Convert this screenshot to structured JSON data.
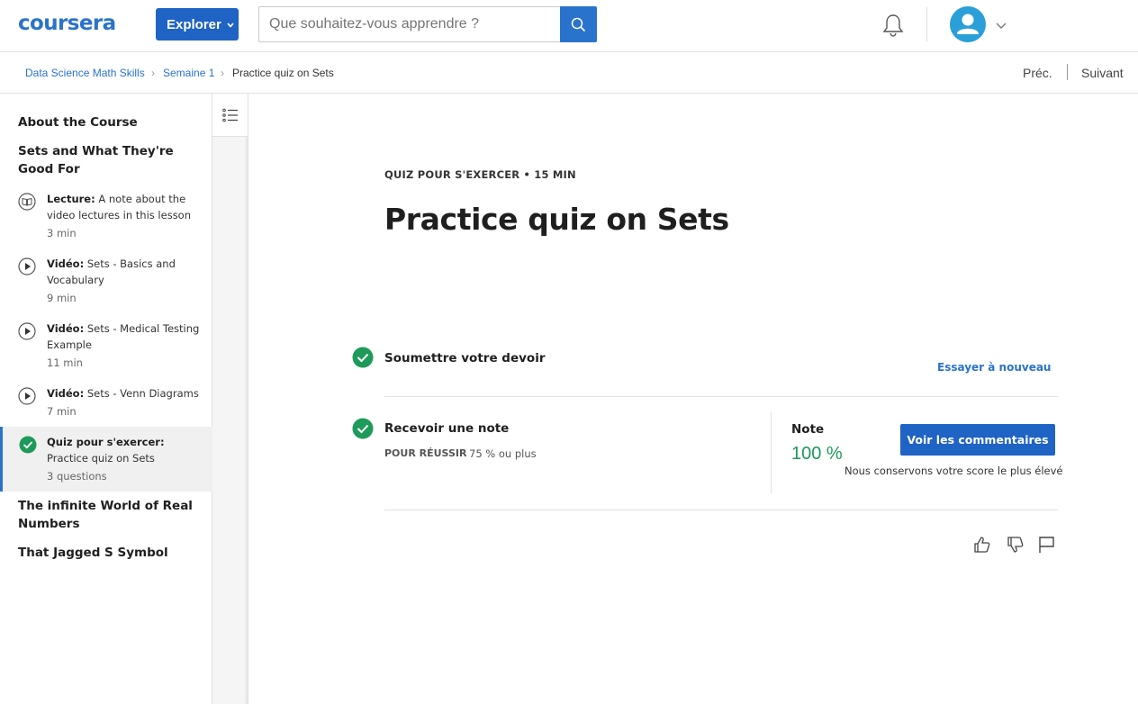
{
  "header": {
    "logo": "coursera",
    "explore_label": "Explorer",
    "search_placeholder": "Que souhaitez-vous apprendre ?"
  },
  "breadcrumb": {
    "items": [
      "Data Science Math Skills",
      "Semaine 1",
      "Practice quiz on Sets"
    ],
    "prev": "Préc.",
    "next": "Suivant"
  },
  "sidebar": {
    "sections": [
      "About the Course",
      "Sets and What They're Good For",
      "The infinite World of Real Numbers",
      "That Jagged S Symbol"
    ],
    "items": [
      {
        "type": "Lecture:",
        "title": "A note about the video lectures in this lesson",
        "meta": "3  min",
        "icon": "book-icon"
      },
      {
        "type": "Vidéo:",
        "title": "Sets - Basics and Vocabulary",
        "meta": "9  min",
        "icon": "play-icon"
      },
      {
        "type": "Vidéo:",
        "title": "Sets - Medical Testing Example",
        "meta": "11  min",
        "icon": "play-icon"
      },
      {
        "type": "Vidéo:",
        "title": "Sets - Venn Diagrams",
        "meta": "7  min",
        "icon": "play-icon"
      },
      {
        "type": "Quiz pour s'exercer:",
        "title": "Practice quiz on Sets",
        "meta": "3 questions",
        "icon": "check-circle-icon"
      }
    ]
  },
  "main": {
    "kicker": "QUIZ POUR S'EXERCER • 15  MIN",
    "title": "Practice quiz on Sets",
    "submit_label": "Soumettre votre devoir",
    "retry_label": "Essayer à nouveau",
    "grade_label": "Recevoir une note",
    "pass_label": "POUR RÉUSSIR",
    "pass_value": "75 % ou plus",
    "note_label": "Note",
    "note_value": "100 %",
    "feedback_button": "Voir les commentaires",
    "keep_text": "Nous conservons votre score le plus élevé"
  },
  "colors": {
    "brand": "#2a73cc",
    "button": "#1f63c4",
    "success": "#1e9a5a"
  }
}
